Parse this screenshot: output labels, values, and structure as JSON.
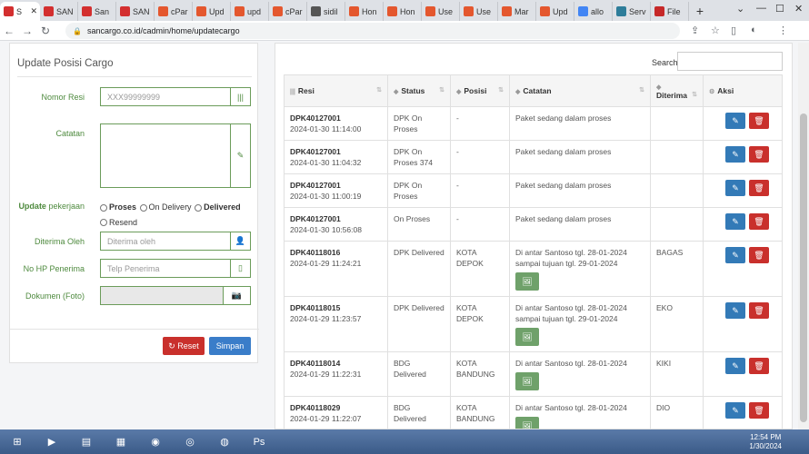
{
  "browser": {
    "tabs": [
      {
        "label": "S",
        "active": true,
        "color": "#d32f2f"
      },
      {
        "label": "SAN",
        "color": "#d32f2f"
      },
      {
        "label": "San",
        "color": "#d32f2f"
      },
      {
        "label": "SAN",
        "color": "#d32f2f"
      },
      {
        "label": "cPar",
        "color": "#e4572e"
      },
      {
        "label": "Upd",
        "color": "#e4572e"
      },
      {
        "label": "upd",
        "color": "#e4572e"
      },
      {
        "label": "cPar",
        "color": "#e4572e"
      },
      {
        "label": "sidil",
        "color": "#555"
      },
      {
        "label": "Hon",
        "color": "#e4572e"
      },
      {
        "label": "Hon",
        "color": "#e4572e"
      },
      {
        "label": "Use",
        "color": "#e4572e"
      },
      {
        "label": "Use",
        "color": "#e4572e"
      },
      {
        "label": "Mar",
        "color": "#e4572e"
      },
      {
        "label": "Upd",
        "color": "#e4572e"
      },
      {
        "label": "allo",
        "color": "#4285f4"
      },
      {
        "label": "Serv",
        "color": "#2e7d9a"
      },
      {
        "label": "File",
        "color": "#c62828"
      }
    ],
    "url": "sancargo.co.id/cadmin/home/updatecargo"
  },
  "form": {
    "title": "Update Posisi Cargo",
    "resi_label": "Nomor Resi",
    "resi_placeholder": "XXX99999999",
    "catatan_label": "Catatan",
    "update_label_bold": "Update",
    "update_label_rest": "pekerjaan",
    "radios": [
      "Proses",
      "On Delivery",
      "Delivered",
      "Resend"
    ],
    "diterima_label": "Diterima Oleh",
    "diterima_placeholder": "Diterima oleh",
    "hp_label": "No HP Penerima",
    "hp_placeholder": "Telp Penerima",
    "dokumen_label": "Dokumen (Foto)",
    "reset_label": "Reset",
    "simpan_label": "Simpan"
  },
  "table": {
    "search_label": "Search:",
    "headers": [
      "Resi",
      "Status",
      "Posisi",
      "Catatan",
      "Diterima",
      "Aksi"
    ],
    "rows": [
      {
        "resi": "DPK40127001",
        "date": "2024-01-30 11:14:00",
        "status": "DPK On Proses",
        "posisi": "-",
        "catatan": "Paket sedang dalam proses",
        "diterima": "",
        "img": false
      },
      {
        "resi": "DPK40127001",
        "date": "2024-01-30 11:04:32",
        "status": "DPK On Proses 374",
        "posisi": "-",
        "catatan": "Paket sedang dalam proses",
        "diterima": "",
        "img": false
      },
      {
        "resi": "DPK40127001",
        "date": "2024-01-30 11:00:19",
        "status": "DPK On Proses",
        "posisi": "-",
        "catatan": "Paket sedang dalam proses",
        "diterima": "",
        "img": false
      },
      {
        "resi": "DPK40127001",
        "date": "2024-01-30 10:56:08",
        "status": "On Proses",
        "posisi": "-",
        "catatan": "Paket sedang dalam proses",
        "diterima": "",
        "img": false
      },
      {
        "resi": "DPK40118016",
        "date": "2024-01-29 11:24:21",
        "status": "DPK Delivered",
        "posisi": "KOTA DEPOK",
        "catatan": "Di antar Santoso tgl. 28-01-2024 sampai tujuan tgl. 29-01-2024",
        "diterima": "BAGAS",
        "img": true
      },
      {
        "resi": "DPK40118015",
        "date": "2024-01-29 11:23:57",
        "status": "DPK Delivered",
        "posisi": "KOTA DEPOK",
        "catatan": "Di antar Santoso tgl. 28-01-2024 sampai tujuan tgl. 29-01-2024",
        "diterima": "EKO",
        "img": true
      },
      {
        "resi": "DPK40118014",
        "date": "2024-01-29 11:22:31",
        "status": "BDG Delivered",
        "posisi": "KOTA BANDUNG",
        "catatan": "Di antar Santoso tgl. 28-01-2024",
        "diterima": "KIKI",
        "img": true
      },
      {
        "resi": "DPK40118029",
        "date": "2024-01-29 11:22:07",
        "status": "BDG Delivered",
        "posisi": "KOTA BANDUNG",
        "catatan": "Di antar Santoso tgl. 28-01-2024",
        "diterima": "DIO",
        "img": true
      }
    ]
  },
  "taskbar": {
    "time": "12:54 PM",
    "date": "1/30/2024"
  },
  "colors": {
    "accent_green": "#4e8a3e",
    "edit_blue": "#337ab7",
    "delete_red": "#c9302c",
    "reset_red": "#c9302c",
    "simpan_blue": "#3a7dc9"
  }
}
